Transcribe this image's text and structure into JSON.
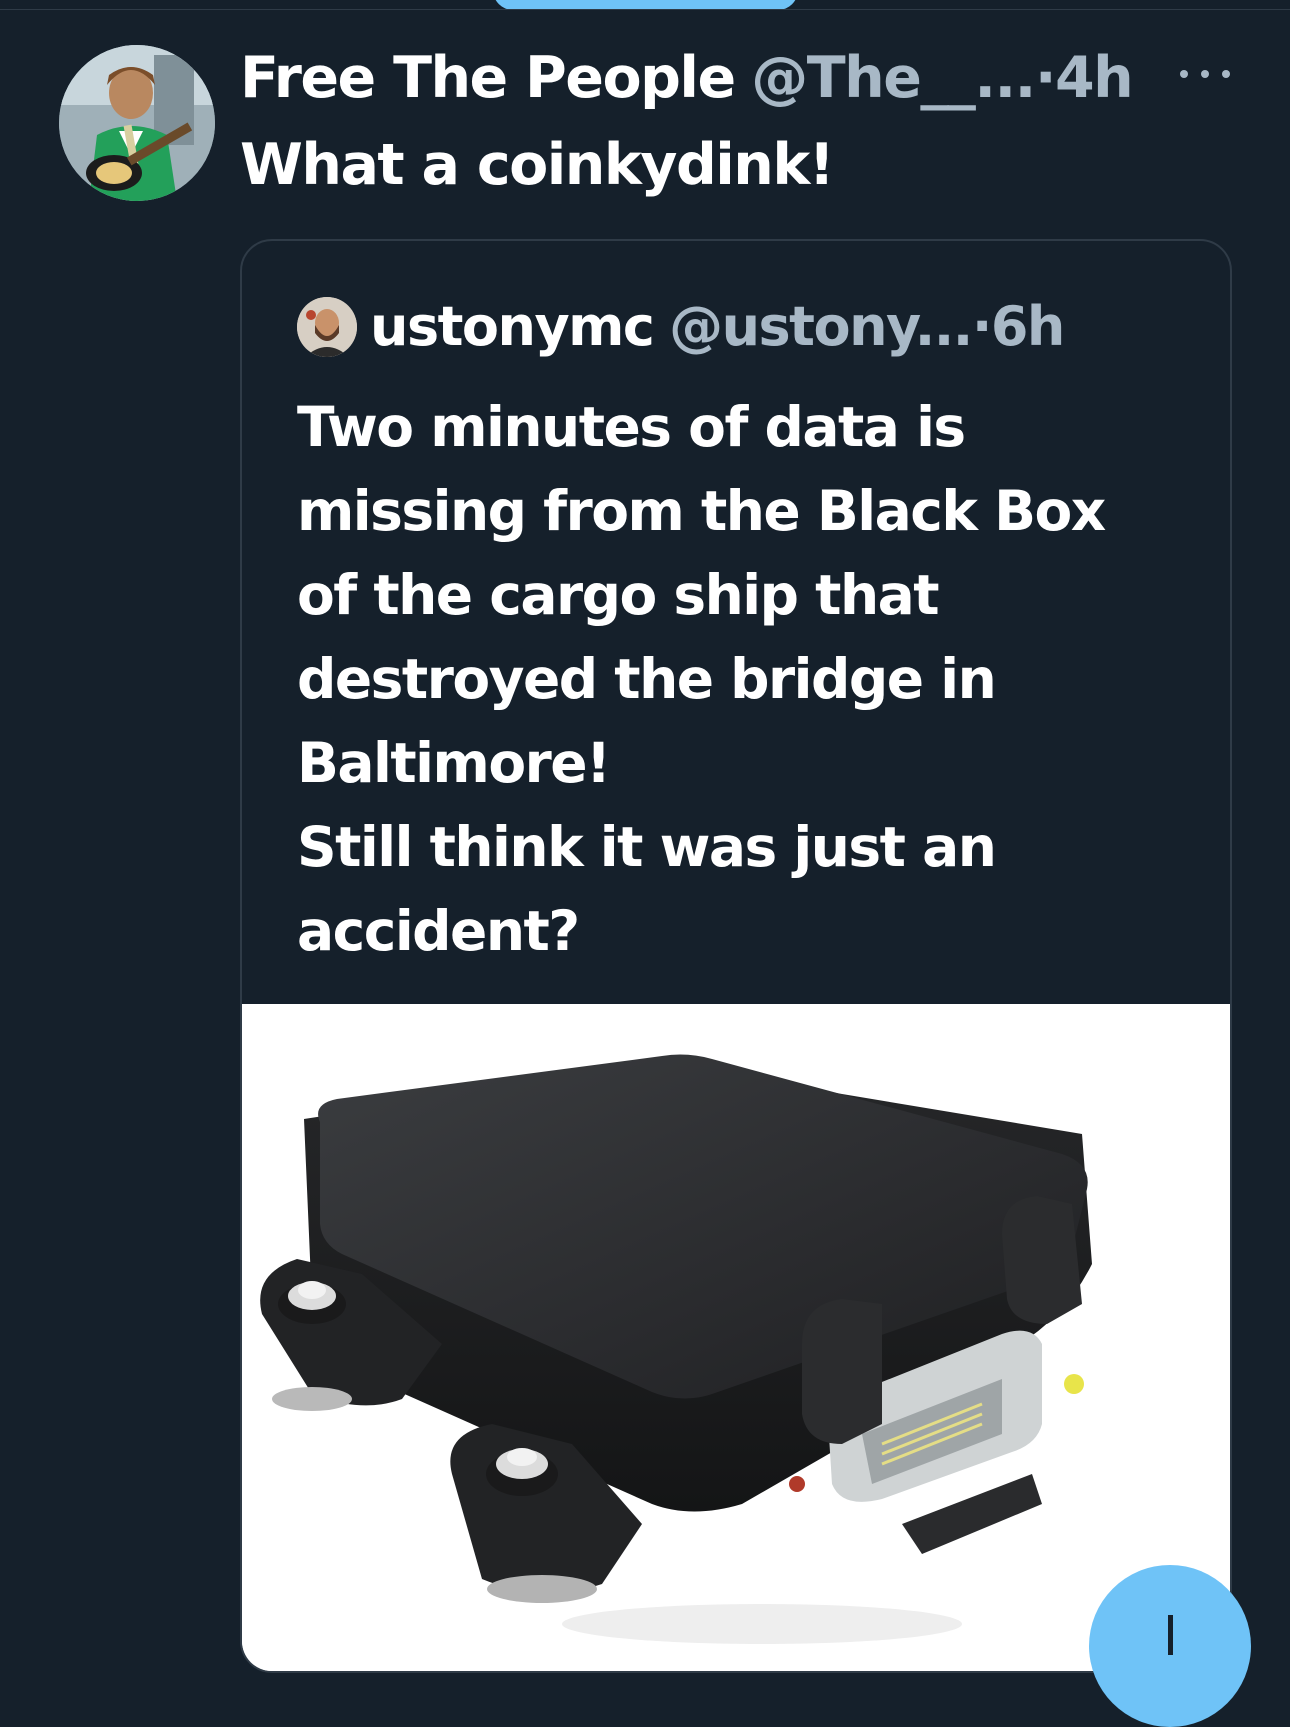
{
  "tweet": {
    "author": {
      "display_name": "Free The People",
      "handle": "@The__...",
      "avatar_icon": "avatar-guitarist"
    },
    "separator": "·",
    "time": "4h",
    "more_icon": "ellipsis-icon",
    "text": "What a coinkydink!"
  },
  "quoted_tweet": {
    "author": {
      "display_name": "ustonymc",
      "handle": "@ustony...",
      "avatar_icon": "avatar-bearded-man"
    },
    "separator": "·",
    "time": "6h",
    "text_lines": [
      "Two minutes of data is",
      "missing from the Black Box",
      "of the cargo ship that",
      "destroyed the bridge in",
      "Baltimore!",
      "Still think it was just an",
      "accident?"
    ],
    "media_icon": "black-box-device-image"
  },
  "compose_button": {
    "icon": "plus-icon"
  },
  "colors": {
    "background": "#15202b",
    "text_primary": "#ffffff",
    "text_secondary": "#a8b8c6",
    "border": "#2f3b47",
    "accent": "#6fc3f7"
  }
}
